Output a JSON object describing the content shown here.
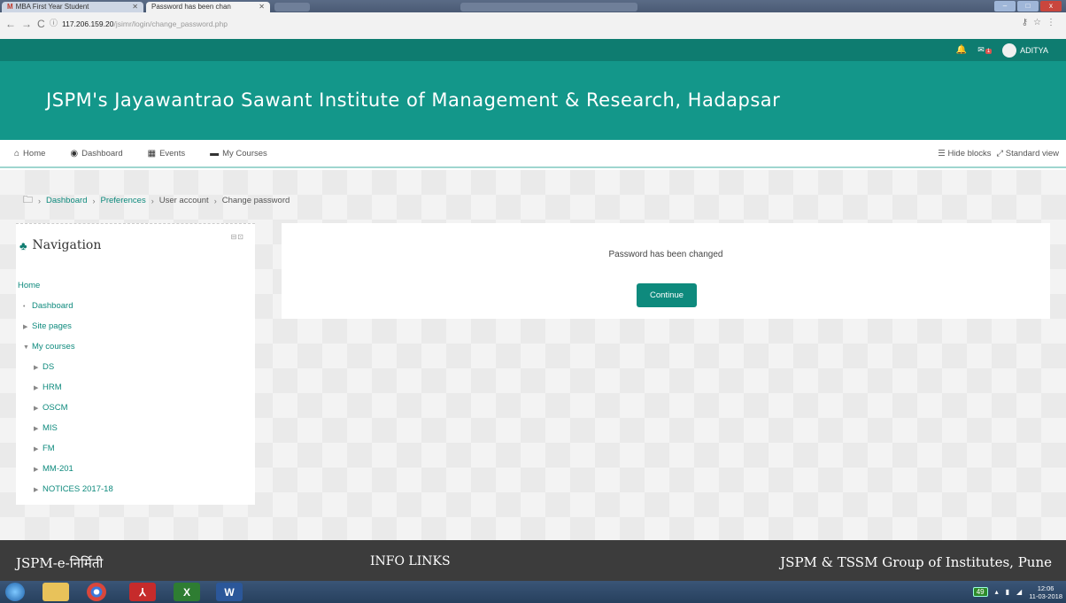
{
  "browser": {
    "tabs": [
      {
        "label": "MBA First Year Student",
        "icon": "gmail-icon"
      },
      {
        "label": "Password has been chan"
      }
    ],
    "url_host": "117.206.159.20",
    "url_path": "/jsimr/login/change_password.php",
    "window_controls": [
      "–",
      "□",
      "x"
    ]
  },
  "topbar": {
    "user_name": "ADITYA",
    "message_badge": "1"
  },
  "header": {
    "title": "JSPM's Jayawantrao Sawant Institute of Management & Research, Hadapsar"
  },
  "navbar": {
    "items": [
      {
        "label": "Home",
        "icon": "home-icon"
      },
      {
        "label": "Dashboard",
        "icon": "dashboard-icon"
      },
      {
        "label": "Events",
        "icon": "calendar-icon"
      },
      {
        "label": "My Courses",
        "icon": "briefcase-icon"
      }
    ],
    "hide_blocks": "Hide blocks",
    "standard_view": "Standard view"
  },
  "breadcrumb": {
    "items": [
      "Dashboard",
      "Preferences",
      "User account",
      "Change password"
    ]
  },
  "navigation_block": {
    "title": "Navigation",
    "items": [
      {
        "label": "Home",
        "level": 0,
        "marker": ""
      },
      {
        "label": "Dashboard",
        "level": 1,
        "marker": "•"
      },
      {
        "label": "Site pages",
        "level": 1,
        "marker": "▶"
      },
      {
        "label": "My courses",
        "level": 1,
        "marker": "▼"
      },
      {
        "label": "DS",
        "level": 2,
        "marker": "▶"
      },
      {
        "label": "HRM",
        "level": 2,
        "marker": "▶"
      },
      {
        "label": "OSCM",
        "level": 2,
        "marker": "▶"
      },
      {
        "label": "MIS",
        "level": 2,
        "marker": "▶"
      },
      {
        "label": "FM",
        "level": 2,
        "marker": "▶"
      },
      {
        "label": "MM-201",
        "level": 2,
        "marker": "▶"
      },
      {
        "label": "NOTICES 2017-18",
        "level": 2,
        "marker": "▶"
      }
    ]
  },
  "main": {
    "message": "Password has been changed",
    "continue_label": "Continue"
  },
  "footer": {
    "left": "JSPM-e-निर्मिती",
    "center": "INFO LINKS",
    "right": "JSPM & TSSM Group of Institutes, Pune"
  },
  "taskbar": {
    "battery": "49",
    "time": "12:06",
    "date": "11-03-2018"
  },
  "colors": {
    "primary": "#0e7c70",
    "banner": "#13978a",
    "link": "#0e8a7d",
    "footer": "#3c3c3c"
  }
}
